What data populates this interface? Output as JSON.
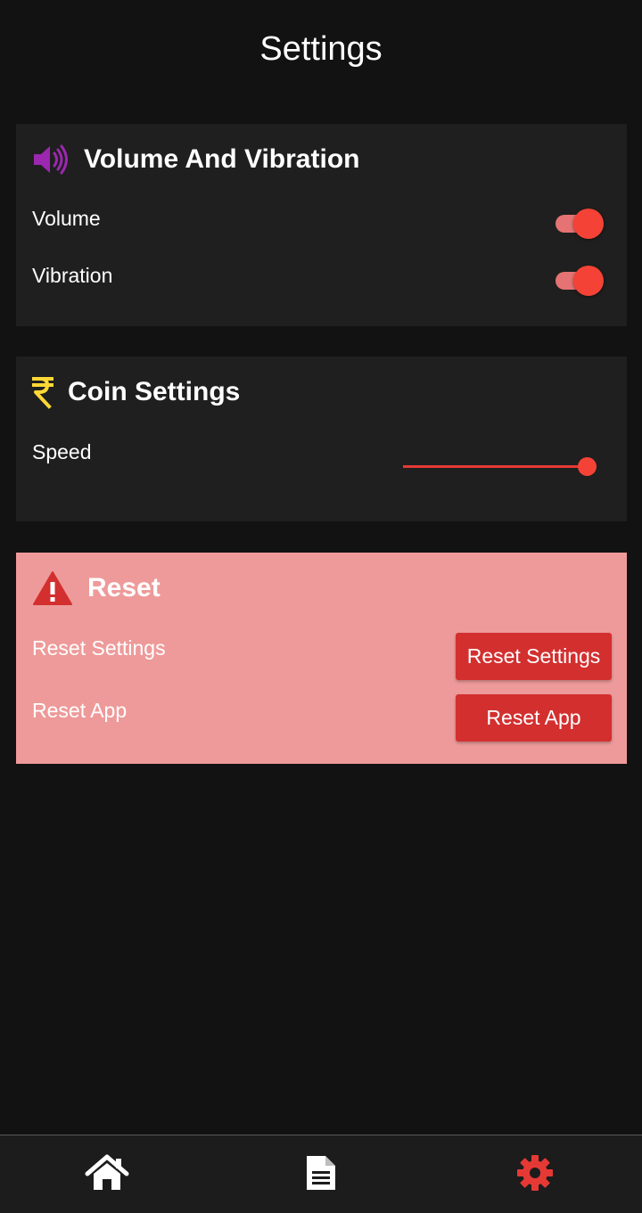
{
  "header": {
    "title": "Settings"
  },
  "volume_section": {
    "title": "Volume And Vibration",
    "icon": "speaker-icon",
    "icon_color": "#9c27b0",
    "rows": [
      {
        "label": "Volume",
        "enabled": true
      },
      {
        "label": "Vibration",
        "enabled": true
      }
    ]
  },
  "coin_section": {
    "title": "Coin Settings",
    "icon": "rupee-icon",
    "icon_color": "#fdd835",
    "speed_label": "Speed",
    "speed_value": 0.95
  },
  "reset_section": {
    "title": "Reset",
    "icon": "warning-icon",
    "icon_color": "#d32f2f",
    "background": "#ee9a9a",
    "reset_settings_label": "Reset Settings",
    "reset_settings_button": "Reset Settings",
    "reset_app_label": "Reset App",
    "reset_app_button": "Reset App"
  },
  "bottom_nav": {
    "items": [
      {
        "icon": "home-icon",
        "active": false
      },
      {
        "icon": "document-icon",
        "active": false
      },
      {
        "icon": "gear-icon",
        "active": true
      }
    ],
    "active_color": "#e53935"
  },
  "colors": {
    "accent": "#f44336",
    "background": "#121212",
    "card": "#1f1f1f"
  }
}
